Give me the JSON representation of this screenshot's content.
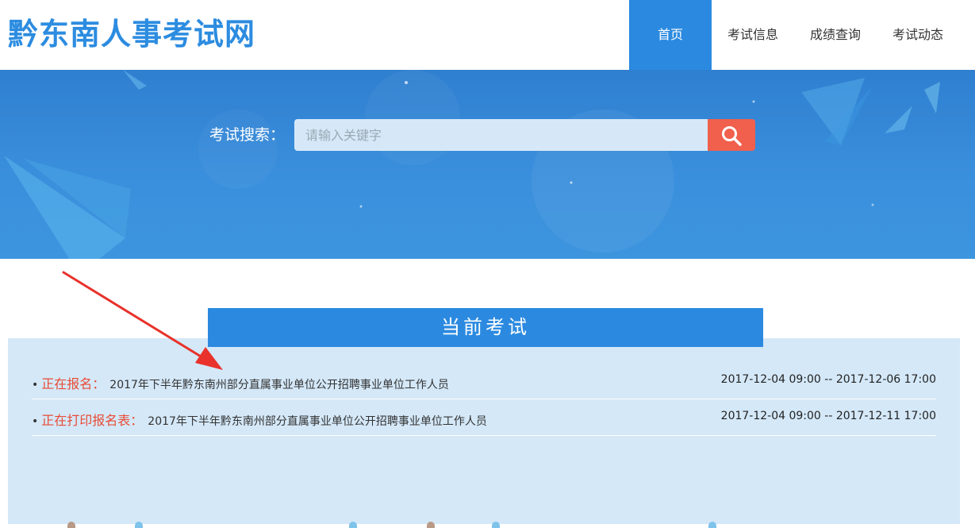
{
  "site": {
    "title": "黔东南人事考试网"
  },
  "nav": {
    "items": [
      {
        "label": "首页",
        "active": true
      },
      {
        "label": "考试信息",
        "active": false
      },
      {
        "label": "成绩查询",
        "active": false
      },
      {
        "label": "考试动态",
        "active": false
      }
    ]
  },
  "search": {
    "label": "考试搜索：",
    "placeholder": "请输入关键字",
    "button_icon": "search-icon"
  },
  "current_exams": {
    "title": "当前考试",
    "rows": [
      {
        "status": "正在报名：",
        "name": "2017年下半年黔东南州部分直属事业单位公开招聘事业单位工作人员",
        "time": "2017-12-04 09:00 -- 2017-12-06 17:00"
      },
      {
        "status": "正在打印报名表：",
        "name": "2017年下半年黔东南州部分直属事业单位公开招聘事业单位工作人员",
        "time": "2017-12-04 09:00 -- 2017-12-11 17:00"
      }
    ]
  },
  "colors": {
    "brand_blue": "#2b8ae0",
    "status_red": "#e94b35",
    "search_button": "#f0604d",
    "panel_bg": "#d4e8f8",
    "annotation_arrow": "#e8322b"
  }
}
